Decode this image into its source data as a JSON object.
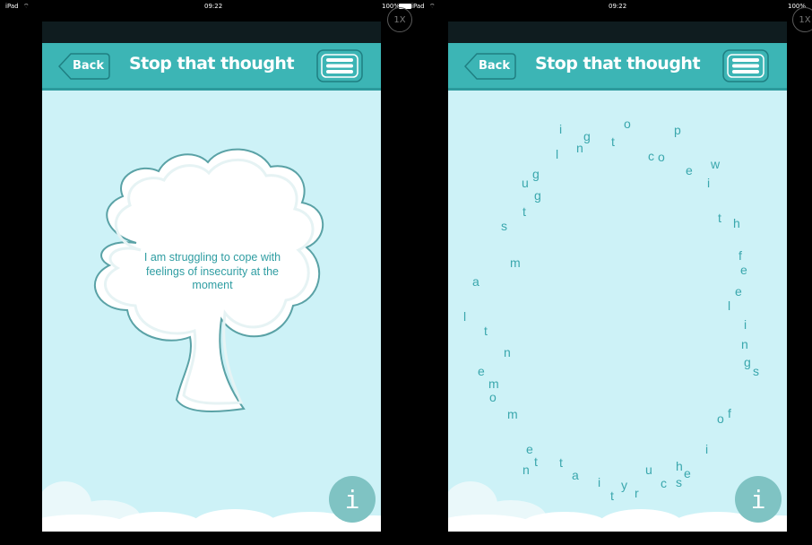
{
  "status_bar": {
    "device": "iPad",
    "time": "09:22",
    "battery": "100%",
    "zoom": "1X"
  },
  "header": {
    "back_label": "Back",
    "title": "Stop that thought"
  },
  "bubble_text": "I am struggling to cope with feelings of insecurity at the moment",
  "info_label": "i",
  "scattered_letters": [
    "i",
    "g",
    "o",
    "p",
    "n",
    "l",
    "t",
    "c",
    "o",
    "e",
    "w",
    "u",
    "g",
    "i",
    "g",
    "t",
    "t",
    "h",
    "s",
    "f",
    "m",
    "e",
    "a",
    "e",
    "l",
    "l",
    "i",
    "t",
    "n",
    "n",
    "g",
    "s",
    "e",
    "m",
    "o",
    "m",
    "o",
    "f",
    "i",
    "e",
    "t",
    "t",
    "n",
    "h",
    "u",
    "e",
    "a",
    "i",
    "y",
    "c",
    "s",
    "t",
    "r"
  ],
  "colors": {
    "header": "#3cb5b5",
    "background": "#cdf2f7",
    "text": "#2f9da2"
  }
}
